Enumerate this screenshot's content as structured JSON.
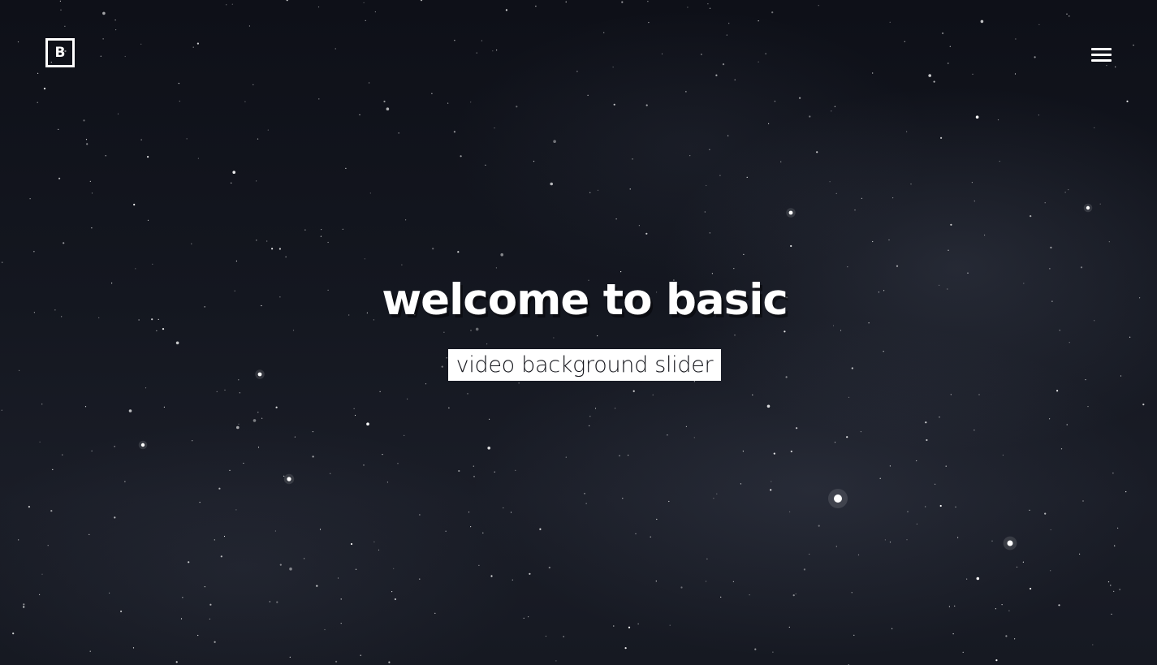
{
  "header": {
    "logo_letter": "B"
  },
  "hero": {
    "headline": "welcome to basic",
    "subtitle": "video background slider"
  },
  "colors": {
    "background": "#0d0f16",
    "text": "#ffffff",
    "subtitle_bg": "#ffffff",
    "subtitle_text": "#15161c"
  },
  "icons": {
    "logo": "logo-b-icon",
    "menu": "hamburger-menu-icon"
  }
}
